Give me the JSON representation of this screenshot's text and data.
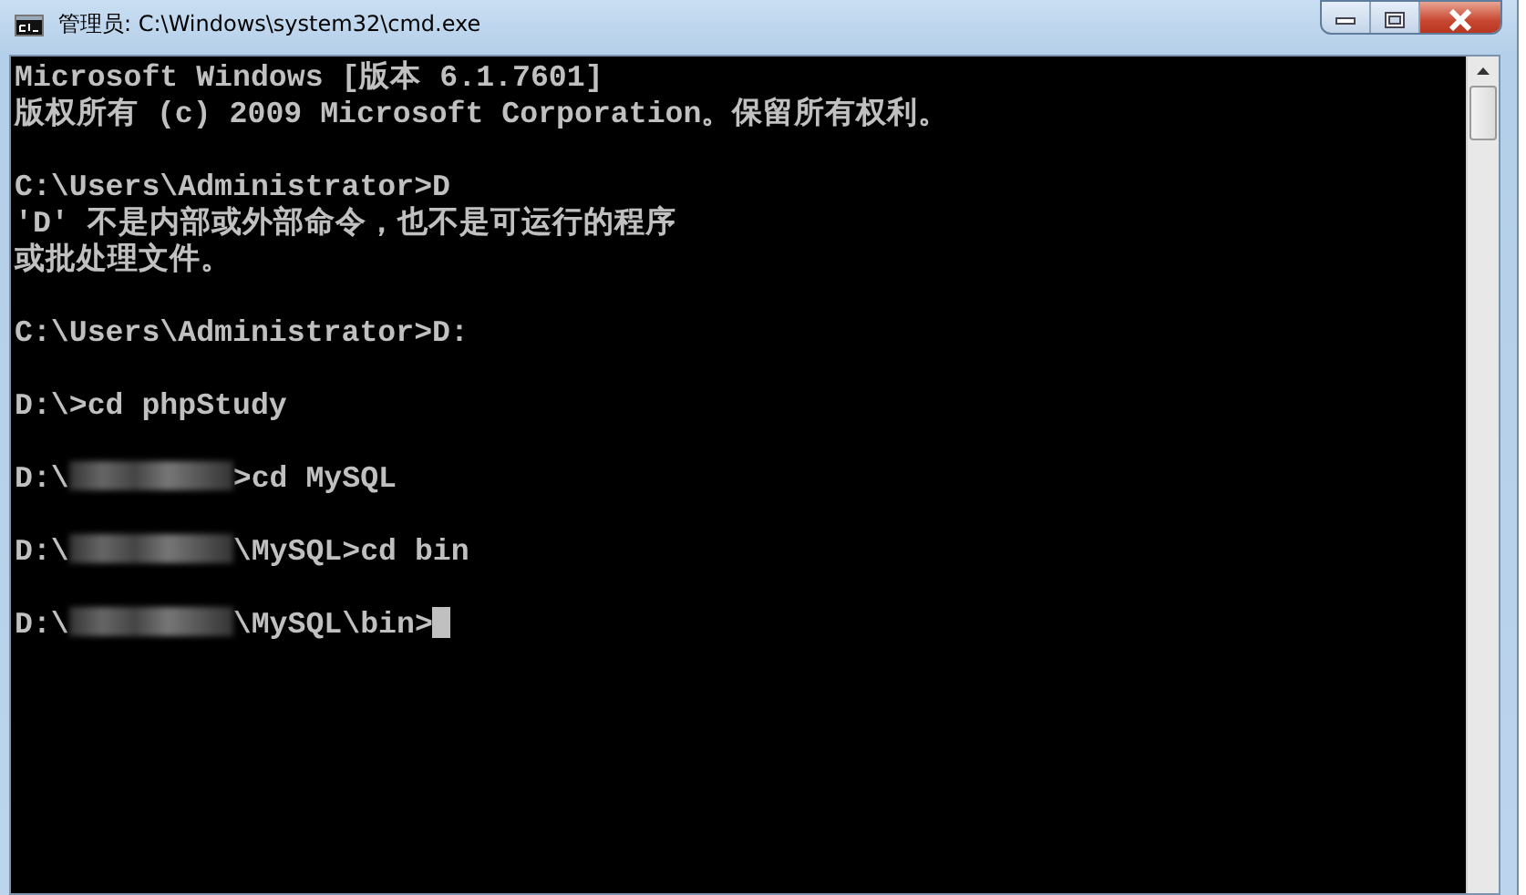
{
  "window": {
    "title": "管理员: C:\\Windows\\system32\\cmd.exe"
  },
  "console": {
    "blocks": [
      [
        {
          "kind": "plain",
          "text": "Microsoft Windows [版本 6.1.7601]"
        },
        {
          "kind": "plain",
          "text": "版权所有 (c) 2009 Microsoft Corporation。保留所有权利。"
        }
      ],
      [
        {
          "kind": "plain",
          "text": "C:\\Users\\Administrator>D"
        },
        {
          "kind": "plain",
          "text": "'D' 不是内部或外部命令，也不是可运行的程序"
        },
        {
          "kind": "plain",
          "text": "或批处理文件。"
        }
      ],
      [
        {
          "kind": "plain",
          "text": "C:\\Users\\Administrator>D:"
        }
      ],
      [
        {
          "kind": "plain",
          "text": "D:\\>cd phpStudy"
        }
      ],
      [
        {
          "kind": "redacted",
          "before": "D:\\",
          "after": ">cd MySQL"
        }
      ],
      [
        {
          "kind": "redacted",
          "before": "D:\\",
          "after": "\\MySQL>cd bin"
        }
      ],
      [
        {
          "kind": "redacted",
          "before": "D:\\",
          "after": "\\MySQL\\bin>",
          "cursor": true
        }
      ]
    ]
  }
}
